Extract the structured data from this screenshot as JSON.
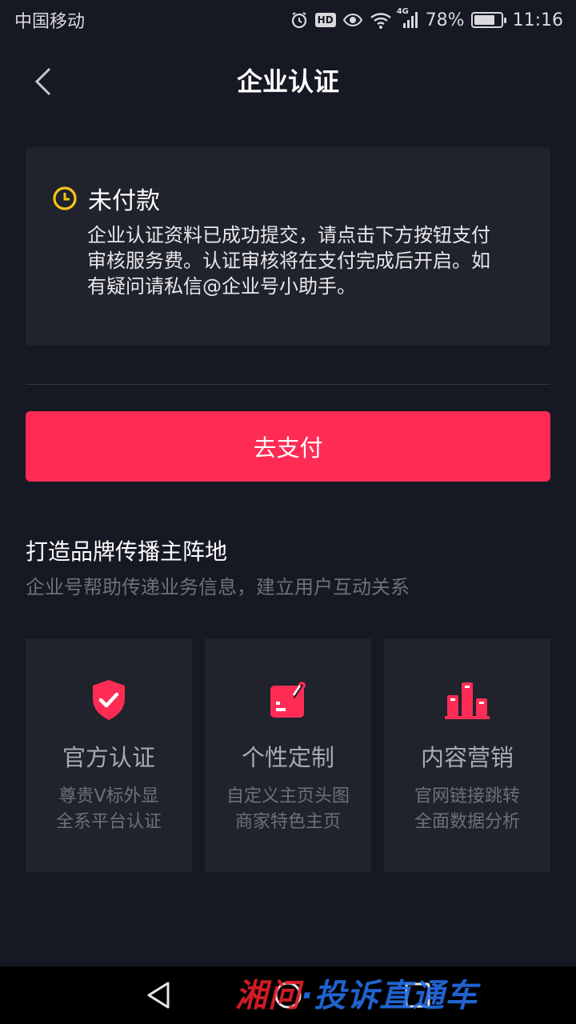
{
  "status_bar": {
    "carrier": "中国移动",
    "hd_badge": "HD",
    "network": "4G",
    "battery_percent": "78%",
    "battery_level": 0.78,
    "time": "11:16",
    "icons": [
      "alarm-icon",
      "hd-icon",
      "eye-icon",
      "wifi-icon",
      "signal-icon",
      "battery-icon"
    ]
  },
  "nav": {
    "title": "企业认证",
    "back_icon": "chevron-left-icon"
  },
  "status_card": {
    "icon": "clock-icon",
    "status": "未付款",
    "lines": [
      "企业认证资料已成功提交，请点击下方按钮支付",
      "审核服务费。认证审核将在支付完成后开启。如",
      "有疑问请私信@企业号小助手。"
    ]
  },
  "pay_button": {
    "label": "去支付"
  },
  "promo": {
    "title": "打造品牌传播主阵地",
    "subtitle": "企业号帮助传递业务信息，建立用户互动关系"
  },
  "features": [
    {
      "icon": "shield-check-icon",
      "title": "官方认证",
      "desc": [
        "尊贵V标外显",
        "全系平台认证"
      ]
    },
    {
      "icon": "custom-card-icon",
      "title": "个性定制",
      "desc": [
        "自定义主页头图",
        "商家特色主页"
      ]
    },
    {
      "icon": "bar-chart-icon",
      "title": "内容营销",
      "desc": [
        "官网链接跳转",
        "全面数据分析"
      ]
    }
  ],
  "system_nav": {
    "buttons": [
      "back-triangle-icon",
      "home-circle-icon",
      "recents-square-icon"
    ]
  },
  "watermark": {
    "red": "湘问",
    "blue": "·投诉直通车"
  },
  "colors": {
    "background": "#161823",
    "card": "#20222c",
    "accent": "#fe2c55",
    "clock": "#f5c518",
    "muted_text": "#6e7079"
  }
}
